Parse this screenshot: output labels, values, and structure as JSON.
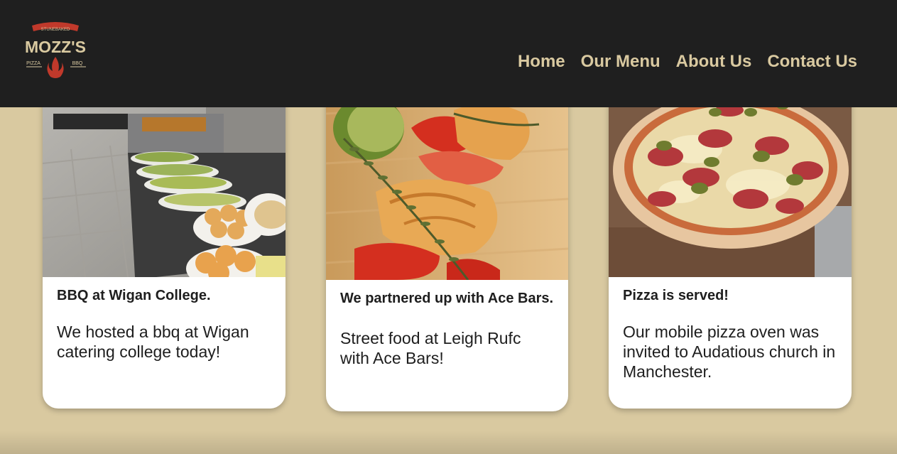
{
  "brand": {
    "logo_small_text": "STUNEBAKED",
    "logo_name": "MOZZ'S",
    "logo_left_word": "PIZZA",
    "logo_right_word": "BBQ",
    "colors": {
      "header_bg": "#1f1f1f",
      "accent": "#d9c9a0",
      "logo_red": "#c0392b"
    }
  },
  "nav": {
    "items": [
      {
        "label": "Home"
      },
      {
        "label": "Our Menu"
      },
      {
        "label": "About Us"
      },
      {
        "label": "Contact Us"
      }
    ]
  },
  "posts": [
    {
      "image": "bbq-buffet-photo",
      "title": "BBQ at Wigan College.",
      "text": "We hosted a bbq at Wigan catering college today!"
    },
    {
      "image": "grilled-skewer-photo",
      "title": "We partnered up with Ace Bars.",
      "text": "Street food at Leigh Rufc with Ace Bars!"
    },
    {
      "image": "pizza-photo",
      "title": "Pizza is served!",
      "text": "Our mobile pizza oven was invited to Audatious church in Manchester."
    }
  ]
}
